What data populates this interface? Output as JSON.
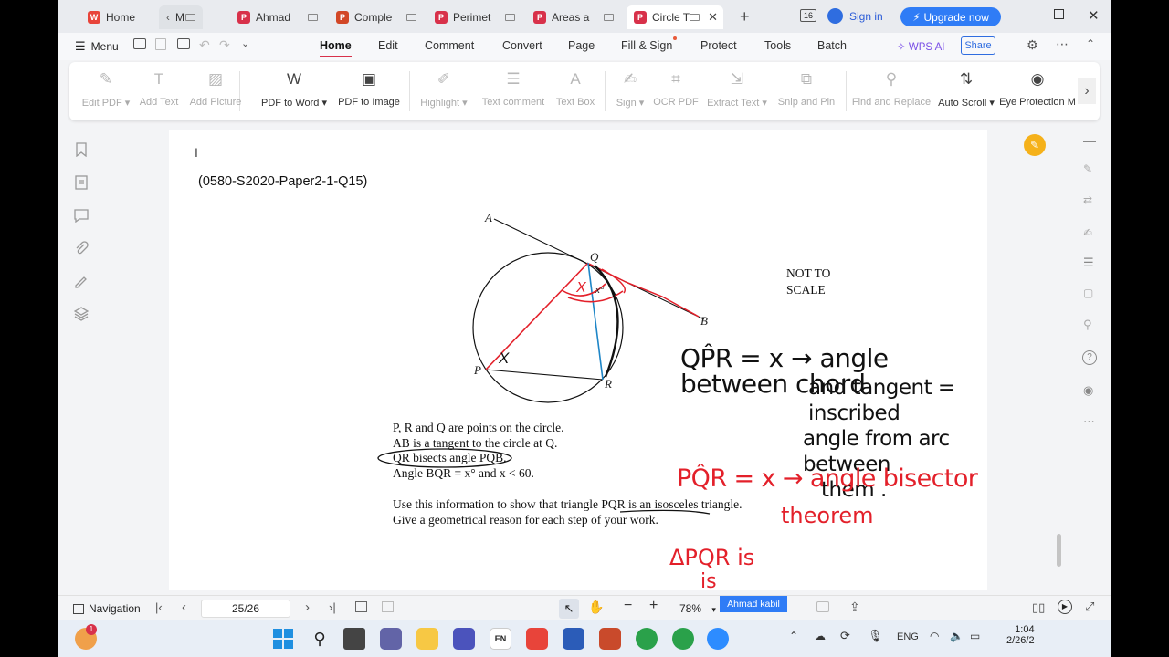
{
  "tabs": [
    {
      "label": "Home",
      "icon": "wps-icon"
    },
    {
      "label": "M",
      "icon": "chevron-left-icon"
    },
    {
      "label": "Ahmad",
      "icon": "pdf-icon"
    },
    {
      "label": "Comple",
      "icon": "ppt-icon"
    },
    {
      "label": "Perimet",
      "icon": "pdf-icon"
    },
    {
      "label": "Areas a",
      "icon": "pdf-icon"
    },
    {
      "label": "Circle T",
      "icon": "pdf-icon",
      "active": true
    }
  ],
  "header": {
    "sign_in": "Sign in",
    "upgrade": "Upgrade now",
    "badge": "16"
  },
  "menu": {
    "menu_label": "Menu",
    "items": [
      "Home",
      "Edit",
      "Comment",
      "Convert",
      "Page",
      "Fill & Sign",
      "Protect",
      "Tools",
      "Batch"
    ],
    "wps_ai": "WPS AI",
    "share": "Share"
  },
  "toolbar": {
    "tools": [
      {
        "label": "Edit PDF",
        "caret": true,
        "disabled": true
      },
      {
        "label": "Add Text",
        "disabled": true
      },
      {
        "label": "Add Picture",
        "disabled": true
      },
      {
        "label": "PDF to Word",
        "caret": true,
        "disabled": false
      },
      {
        "label": "PDF to Image",
        "disabled": false
      },
      {
        "label": "Highlight",
        "caret": true,
        "disabled": true
      },
      {
        "label": "Text comment",
        "disabled": true
      },
      {
        "label": "Text Box",
        "disabled": true
      },
      {
        "label": "Sign",
        "caret": true,
        "disabled": true
      },
      {
        "label": "OCR PDF",
        "disabled": true
      },
      {
        "label": "Extract Text",
        "caret": true,
        "disabled": true
      },
      {
        "label": "Snip and Pin",
        "disabled": true
      },
      {
        "label": "Find and Replace",
        "disabled": true
      },
      {
        "label": "Auto Scroll",
        "caret": true,
        "disabled": false
      },
      {
        "label": "Eye Protection M",
        "disabled": false
      }
    ]
  },
  "document": {
    "ref": "(0580-S2020-Paper2-1-Q15)",
    "not_to_scale_1": "NOT TO",
    "not_to_scale_2": "SCALE",
    "labels": {
      "A": "A",
      "Q": "Q",
      "B": "B",
      "P": "P",
      "R": "R",
      "x": "x°"
    },
    "lines": [
      "P, R and Q are points on the circle.",
      "AB is a tangent to the circle at Q.",
      "QR bisects angle PQB.",
      "Angle BQR = x° and x < 60."
    ],
    "instruction_1": "Use this information to show that triangle PQR is an isosceles triangle.",
    "instruction_2": "Give a geometrical reason for each step of your work."
  },
  "handwriting": {
    "black_1": "QP̂R = x → angle between chord",
    "black_2": "and tangent = inscribed",
    "black_3": "angle from arc between",
    "black_4": "them .",
    "red_1": "PQ̂R = x → angle bisector",
    "red_2": "theorem",
    "red_3": "ΔPQR is",
    "red_4": "is",
    "red_x1": "X",
    "red_x2": "X"
  },
  "status": {
    "navigation": "Navigation",
    "page": "25/26",
    "zoom": "78%",
    "user_tag": "Ahmad kabil"
  },
  "taskbar": {
    "lang": "ENG",
    "time": "1:04",
    "date": "2/26/2",
    "notif": "1"
  },
  "colors": {
    "accent": "#d8314a",
    "upgrade": "#2f7cf6",
    "ink_red": "#e3202a",
    "ink_black": "#111111",
    "ink_blue": "#1f86c7"
  }
}
